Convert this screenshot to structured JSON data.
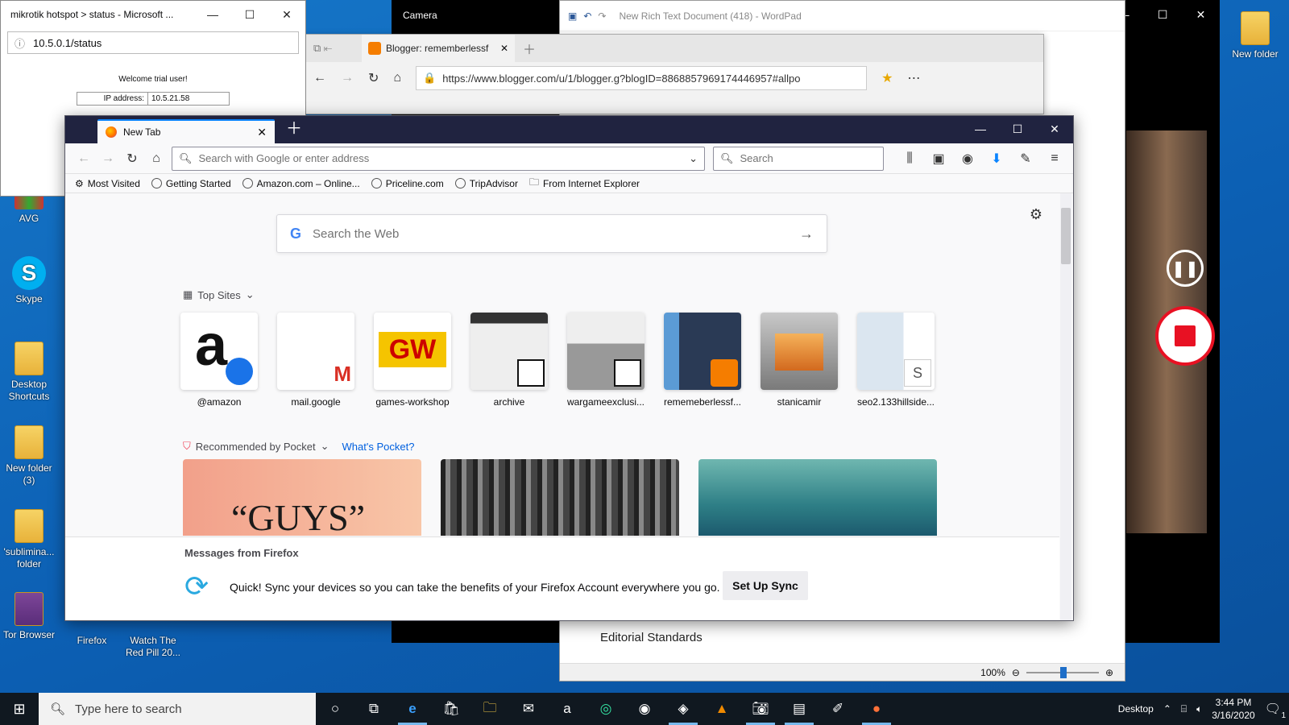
{
  "desktop": {
    "icons_left": [
      {
        "label": "AVG"
      },
      {
        "label": "Skype"
      },
      {
        "label": "Desktop Shortcuts"
      },
      {
        "label": "New folder (3)"
      },
      {
        "label": "'sublimina... folder"
      },
      {
        "label": "Tor Browser"
      }
    ],
    "icons_bottom": [
      {
        "label": "Firefox"
      },
      {
        "label": "Watch The Red Pill 20..."
      }
    ],
    "icon_right": {
      "label": "New folder"
    }
  },
  "ie_window": {
    "title": "mikrotik hotspot > status - Microsoft ...",
    "url": "10.5.0.1/status",
    "welcome": "Welcome trial user!",
    "ip_label": "IP address:",
    "ip_value": "10.5.21.58"
  },
  "camera_window": {
    "title": "Camera"
  },
  "wordpad": {
    "title": "New Rich Text Document (418) - WordPad",
    "body_text": "Editorial Standards",
    "zoom": "100%"
  },
  "edge": {
    "tab_title": "Blogger: rememberlessf",
    "url": "https://www.blogger.com/u/1/blogger.g?blogID=8868857969174446957#allpo"
  },
  "firefox": {
    "tab_title": "New Tab",
    "url_placeholder": "Search with Google or enter address",
    "search_placeholder": "Search",
    "bookmarks": [
      "Most Visited",
      "Getting Started",
      "Amazon.com – Online...",
      "Priceline.com",
      "TripAdvisor",
      "From Internet Explorer"
    ],
    "web_search_placeholder": "Search the Web",
    "top_sites_label": "Top Sites",
    "top_sites": [
      {
        "label": "@amazon"
      },
      {
        "label": "mail.google"
      },
      {
        "label": "games-workshop"
      },
      {
        "label": "archive"
      },
      {
        "label": "wargameexclusi..."
      },
      {
        "label": "rememeberlessf..."
      },
      {
        "label": "stanicamir"
      },
      {
        "label": "seo2.133hillside..."
      }
    ],
    "pocket_label": "Recommended by Pocket",
    "pocket_link": "What's Pocket?",
    "pocket_card_text": "“GUYS”",
    "messages_label": "Messages from Firefox",
    "sync_message": "Quick! Sync your devices so you can take the benefits of your Firefox Account everywhere you go.",
    "sync_button": "Set Up Sync"
  },
  "taskbar": {
    "search_placeholder": "Type here to search",
    "desktop_label": "Desktop",
    "time": "3:44 PM",
    "date": "3/16/2020",
    "notifications": "1"
  }
}
